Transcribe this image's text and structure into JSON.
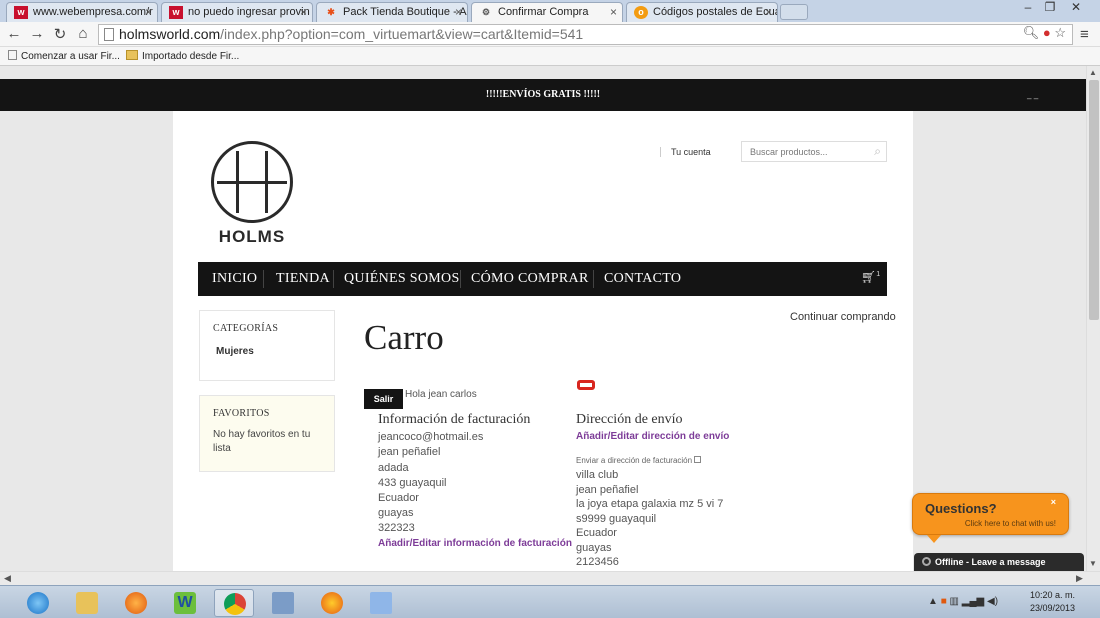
{
  "browser": {
    "tabs": [
      {
        "label": "www.webempresa.com/r",
        "favicon": "w"
      },
      {
        "label": "no puedo ingresar provin",
        "favicon": "w"
      },
      {
        "label": "Pack Tienda Boutique - A",
        "favicon": "x"
      },
      {
        "label": "Confirmar Compra",
        "favicon": "gear"
      },
      {
        "label": "Códigos postales de Ecua",
        "favicon": "o"
      }
    ],
    "url_host": "holmsworld.com",
    "url_path": "/index.php?option=com_virtuemart&view=cart&Itemid=541",
    "bookmarks": [
      "Comenzar a usar Fir...",
      "Importado desde Fir..."
    ]
  },
  "site": {
    "promo": "!!!!!ENVÍOS GRATIS !!!!!",
    "promo_right": "_ _",
    "logo_word": "HOLMS",
    "account_link": "Tu cuenta",
    "search_placeholder": "Buscar productos...",
    "nav": [
      "INICIO",
      "TIENDA",
      "QUIÉNES SOMOS",
      "CÓMO COMPRAR",
      "CONTACTO"
    ],
    "cart_count": "1"
  },
  "sidebar": {
    "categories_title": "CATEGORÍAS",
    "categories": [
      "Mujeres"
    ],
    "favorites_title": "FAVORITOS",
    "favorites_empty": "No hay favoritos en tu lista"
  },
  "cart": {
    "title": "Carro",
    "continue_link": "Continuar comprando",
    "logout_button": "Salir",
    "greeting": "Hola jean carlos",
    "billing": {
      "heading": "Información de facturación",
      "lines": [
        "jeancoco@hotmail.es",
        "jean peñafiel",
        "adada",
        "433 guayaquil",
        "Ecuador",
        "guayas",
        "322323"
      ],
      "edit_link": "Añadir/Editar información de facturación"
    },
    "shipping": {
      "heading": "Dirección de envío",
      "edit_link": "Añadir/Editar dirección de envío",
      "same_as_billing": "Enviar a dirección de facturación",
      "lines": [
        "villa club",
        "jean peñafiel",
        "la joya etapa galaxia mz 5 vi 7",
        "s9999 guayaquil",
        "Ecuador",
        "guayas",
        "2123456"
      ]
    }
  },
  "chat": {
    "title": "Questions?",
    "subtitle": "Click here to chat with us!",
    "close": "×",
    "status": "Offline - Leave a message"
  },
  "taskbar": {
    "time": "10:20 a. m.",
    "date": "23/09/2013"
  },
  "colors": {
    "dark": "#141414",
    "link_purple": "#7d3c98",
    "chat_orange": "#f7941d",
    "red_icon": "#d8261f"
  }
}
